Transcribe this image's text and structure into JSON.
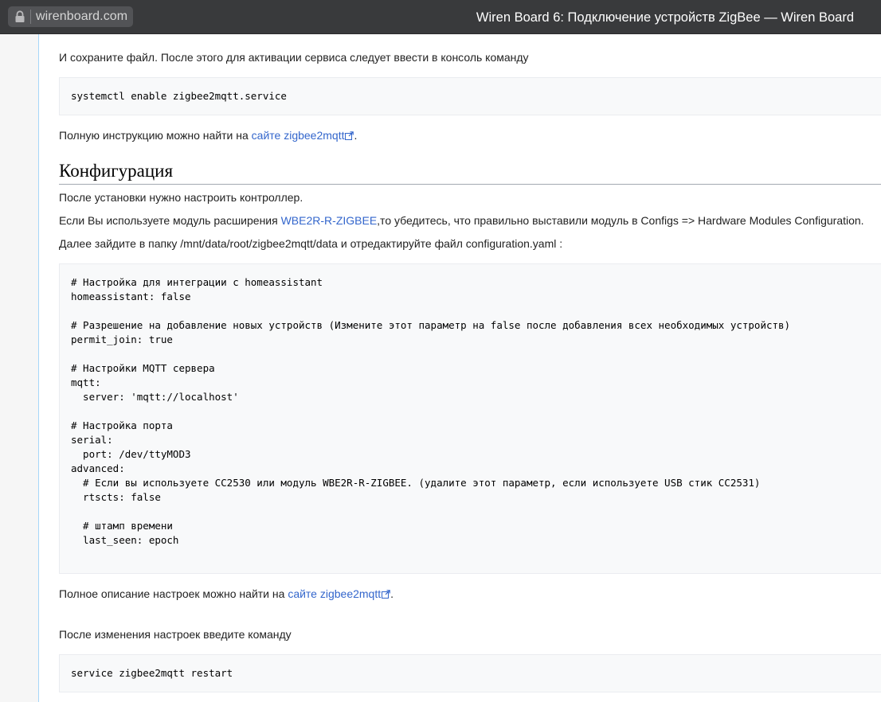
{
  "browser": {
    "url": "wirenboard.com",
    "window_title": "Wiren Board 6: Подключение устройств ZigBee — Wiren Board"
  },
  "article": {
    "p_save": "И сохраните файл. После этого для активации сервиса следует ввести в консоль команду",
    "code_enable": "systemctl enable zigbee2mqtt.service",
    "p_instruction_before": "Полную инструкцию можно найти на ",
    "link_zigbee_site_1": "сайте zigbee2mqtt",
    "p_instruction_after": ".",
    "heading_config": "Конфигурация",
    "p_after_install": "После установки нужно настроить контроллер.",
    "p_module_before": "Если Вы используете модуль расширения ",
    "link_module": "WBE2R-R-ZIGBEE",
    "p_module_after": ",то убедитесь, что правильно выставили модуль в Configs => Hardware Modules Configuration.",
    "p_folder": "Далее зайдите в папку /mnt/data/root/zigbee2mqtt/data и отредактируйте файл configuration.yaml :",
    "code_config": "# Настройка для интеграции с homeassistant\nhomeassistant: false\n\n# Разрешение на добавление новых устройств (Измените этот параметр на false после добавления всех необходимых устройств)\npermit_join: true\n\n# Настройки MQTT сервера\nmqtt:\n  server: 'mqtt://localhost'\n\n# Настройка порта\nserial:\n  port: /dev/ttyMOD3\nadvanced:\n  # Если вы используете CC2530 или модуль WBE2R-R-ZIGBEE. (удалите этот параметр, если используете USB стик CC2531)\n  rtscts: false\n\n  # штамп времени\n  last_seen: epoch",
    "p_full_desc_before": "Полное описание настроек можно найти на ",
    "link_zigbee_site_2": "сайте zigbee2mqtt",
    "p_full_desc_after": ".",
    "p_after_change": "После изменения настроек введите команду",
    "code_restart": "service zigbee2mqtt restart"
  }
}
